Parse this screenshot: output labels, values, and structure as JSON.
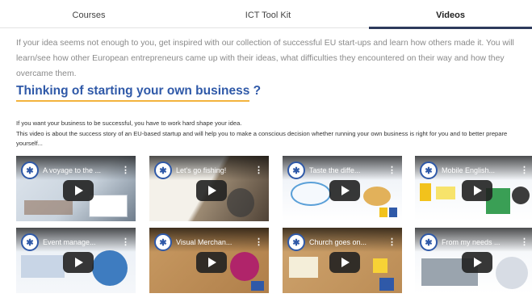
{
  "tabs": [
    {
      "label": "Courses",
      "active": false
    },
    {
      "label": "ICT Tool Kit",
      "active": false
    },
    {
      "label": "Videos",
      "active": true
    }
  ],
  "intro_text": "If your idea seems not enough to you, get inspired with our collection of successful EU start-ups and learn how others made it. You will learn/see how other European entrepreneurs came up with their ideas, what difficulties they encountered on their way and how they overcame them.",
  "heading": "Thinking of starting your own business ?",
  "subtext_line1": "If you want your business to be successful, you have to work hard shape your idea.",
  "subtext_line2": "This video is about the success story of an EU-based startup and will help you to make a conscious decision whether running your own business is right for you and to better prepare yourself...",
  "colors": {
    "accent": "#2f59a8",
    "underline": "#f3b33d",
    "active_tab_line": "#2d3a5c"
  },
  "videos": [
    {
      "title": "A voyage to the ...",
      "icon": "play-icon"
    },
    {
      "title": "Let's go fishing!",
      "icon": "play-icon"
    },
    {
      "title": "Taste the diffe...",
      "icon": "play-icon"
    },
    {
      "title": "Mobile English...",
      "icon": "play-icon"
    },
    {
      "title": "Event manage...",
      "icon": "play-icon"
    },
    {
      "title": "Visual Merchan...",
      "icon": "play-icon"
    },
    {
      "title": "Church goes on...",
      "icon": "play-icon"
    },
    {
      "title": "From my needs ...",
      "icon": "play-icon"
    }
  ]
}
